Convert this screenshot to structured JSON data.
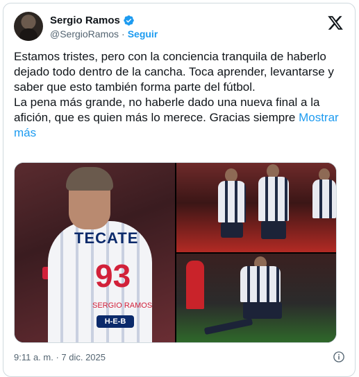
{
  "tweet": {
    "author": {
      "display_name": "Sergio Ramos",
      "handle": "@SergioRamos",
      "separator": "·",
      "follow_label": "Seguir",
      "verified": true
    },
    "text": "Estamos tristes, pero con la conciencia tranquila de haberlo dejado todo dentro de la cancha. Toca aprender, levantarse y saber que esto también forma parte del fútbol.\nLa pena más grande, no haberle dado una nueva final a la afición, que es quien más lo merece. Gracias siempre ",
    "show_more_label": "Mostrar más",
    "timestamp": "9:11 a. m. · 7 dic. 2025",
    "media": {
      "photo1": {
        "shirt_brand": "TECATE",
        "shirt_number": "93",
        "shirt_name": "SERGIO RAMOS",
        "shirt_sponsor": "H-E-B"
      }
    }
  },
  "colors": {
    "link": "#1d9bf0",
    "secondary_text": "#536471",
    "border": "#cfd9de",
    "verified": "#1d9bf0"
  },
  "icons": {
    "verified": "verified-badge-icon",
    "logo": "x-logo-icon",
    "info": "info-icon"
  }
}
